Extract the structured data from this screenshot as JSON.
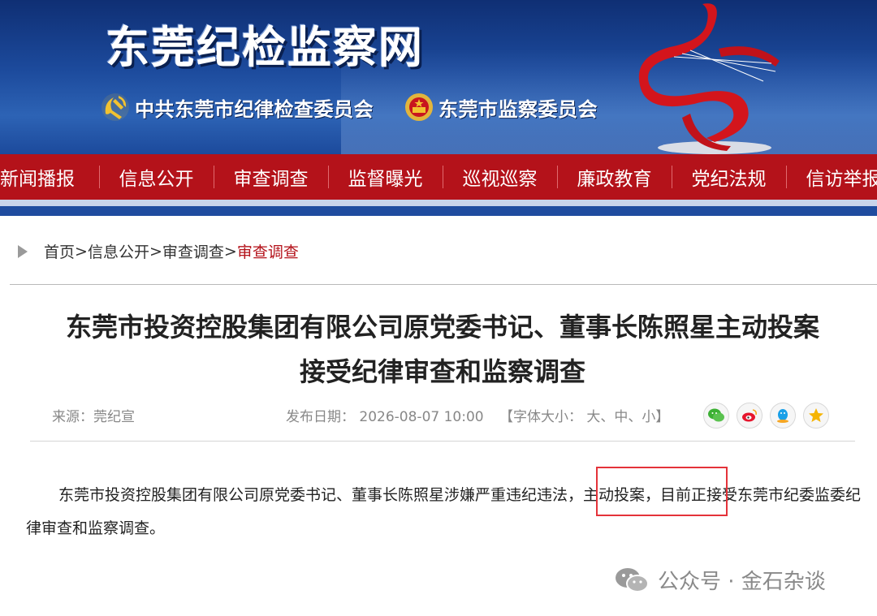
{
  "header": {
    "site_title": "东莞纪检监察网",
    "org1": "中共东莞市纪律检查委员会",
    "org2": "东莞市监察委员会",
    "icons": [
      "party-emblem-icon",
      "national-emblem-icon"
    ]
  },
  "nav": {
    "items": [
      {
        "label": "新闻播报"
      },
      {
        "label": "信息公开"
      },
      {
        "label": "审查调查"
      },
      {
        "label": "监督曝光"
      },
      {
        "label": "巡视巡察"
      },
      {
        "label": "廉政教育"
      },
      {
        "label": "党纪法规"
      },
      {
        "label": "信访举报"
      }
    ]
  },
  "breadcrumb": {
    "home": "首页",
    "level1": "信息公开",
    "level2": "审查调查",
    "current": "审查调查",
    "sep": ">"
  },
  "article": {
    "title_line1": "东莞市投资控股集团有限公司原党委书记、董事长陈照星主动投案",
    "title_line2": "接受纪律审查和监察调查",
    "source": "来源：莞纪宣",
    "date_label": "发布日期：",
    "date": "2026-08-07 10:00",
    "font_size_label": "【字体大小：",
    "font_size_large": "大",
    "font_size_medium": "中",
    "font_size_small": "小",
    "font_size_end": "】",
    "punct": "、",
    "share_icons": [
      "wechat-share-icon",
      "weibo-share-icon",
      "qq-share-icon",
      "favorite-star-icon"
    ],
    "body": "东莞市投资控股集团有限公司原党委书记、董事长陈照星涉嫌严重违纪违法，主动投案，目前正接受东莞市纪委监委纪律审查和监察调查。"
  },
  "watermark": {
    "text": "公众号 · 金石杂谈"
  },
  "colors": {
    "nav_red": "#b4121a",
    "banner_blue": "#1c4a9c",
    "highlight_red": "#e4333a"
  }
}
